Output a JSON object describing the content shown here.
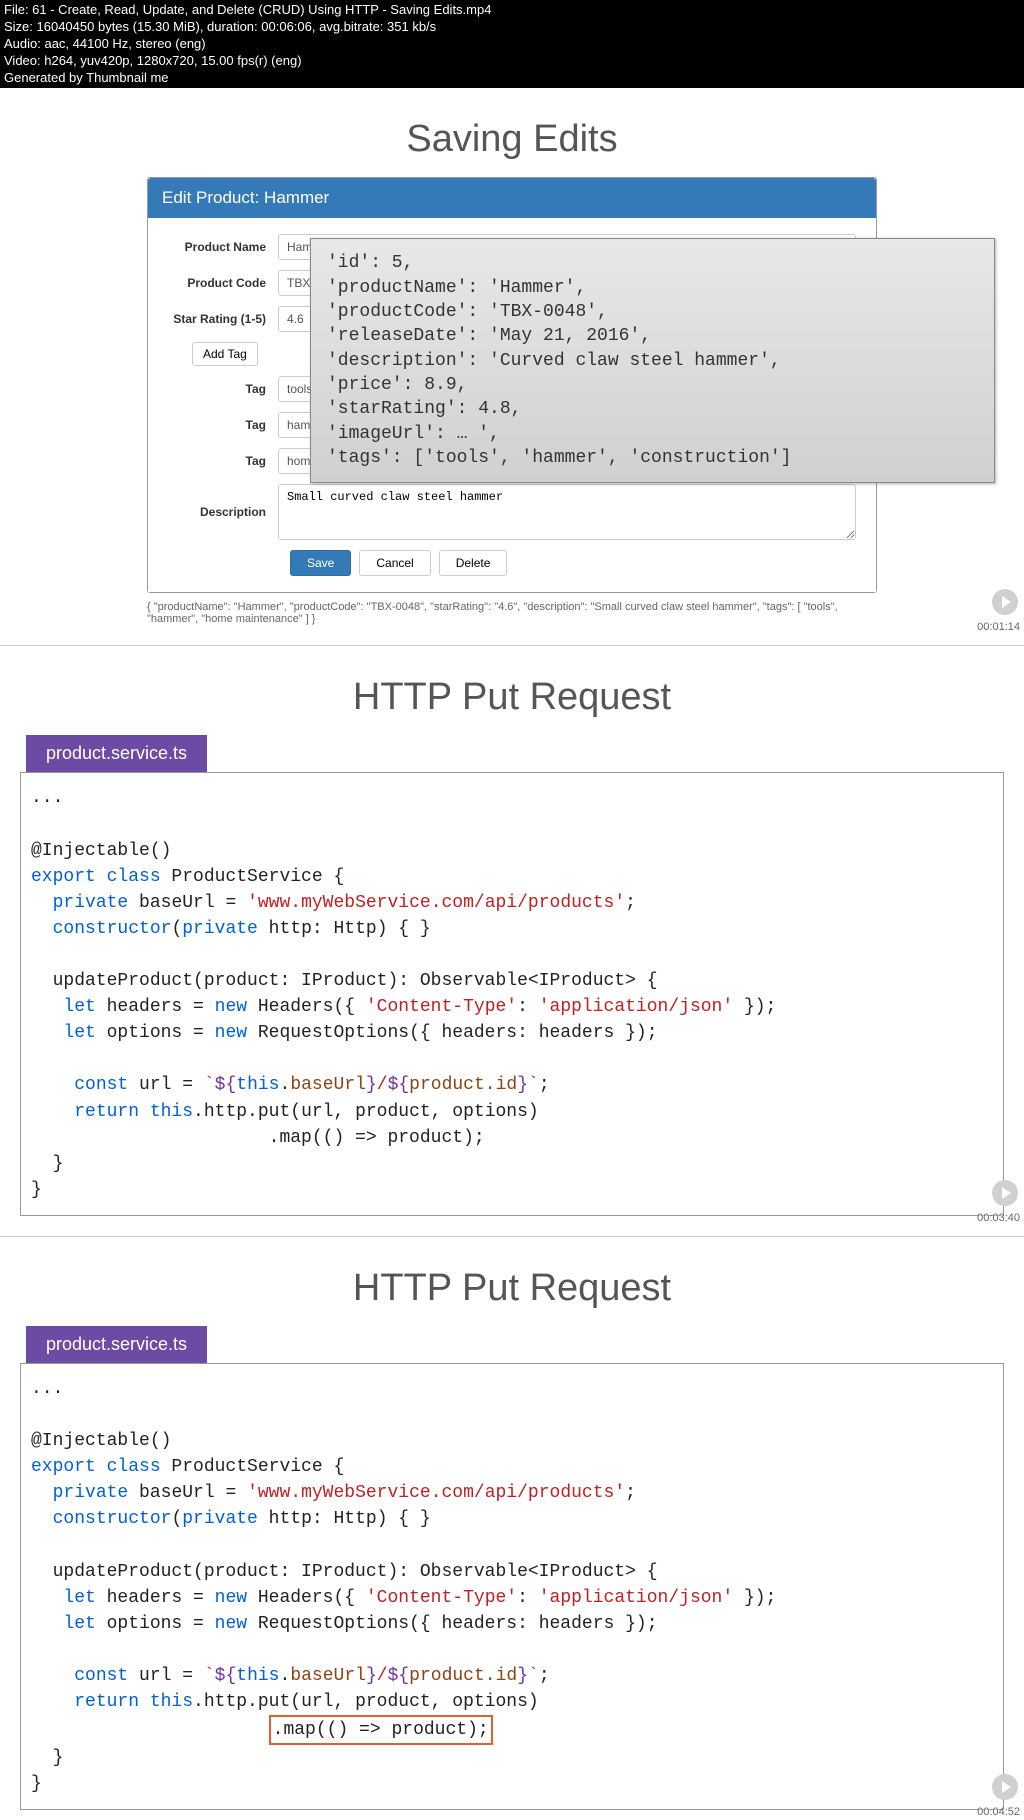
{
  "header": {
    "file_line": "File: 61 - Create, Read, Update, and Delete (CRUD) Using HTTP - Saving Edits.mp4",
    "size_line": "Size: 16040450 bytes (15.30 MiB), duration: 00:06:06, avg.bitrate: 351 kb/s",
    "audio_line": "Audio: aac, 44100 Hz, stereo (eng)",
    "video_line": "Video: h264, yuv420p, 1280x720, 15.00 fps(r) (eng)",
    "gen_line": "Generated by Thumbnail me"
  },
  "slide1": {
    "title": "Saving Edits",
    "form_title": "Edit Product: Hammer",
    "labels": {
      "product_name": "Product Name",
      "product_code": "Product Code",
      "star_rating": "Star Rating (1-5)",
      "tag": "Tag",
      "description": "Description"
    },
    "values": {
      "product_name": "Hammer",
      "product_code": "TBX-0048",
      "star_rating": "4.6",
      "tag1": "tools",
      "tag2": "hammer",
      "tag3": "home maintenance",
      "description": "Small curved claw steel hammer"
    },
    "buttons": {
      "add_tag": "Add Tag",
      "save": "Save",
      "cancel": "Cancel",
      "delete": "Delete"
    },
    "overlay": "'id': 5,\n'productName': 'Hammer',\n'productCode': 'TBX-0048',\n'releaseDate': 'May 21, 2016',\n'description': 'Curved claw steel hammer',\n'price': 8.9,\n'starRating': 4.8,\n'imageUrl': … ',\n'tags': ['tools', 'hammer', 'construction']",
    "footer_json": "{ \"productName\": \"Hammer\", \"productCode\": \"TBX-0048\", \"starRating\": \"4.6\", \"description\": \"Small curved claw steel hammer\", \"tags\": [ \"tools\", \"hammer\", \"home maintenance\" ] }",
    "timestamp": "00:01:14"
  },
  "slide2": {
    "title": "HTTP Put Request",
    "tab": "product.service.ts",
    "timestamp": "00:03:40"
  },
  "slide3": {
    "title": "HTTP Put Request",
    "tab": "product.service.ts",
    "timestamp": "00:04:52"
  }
}
